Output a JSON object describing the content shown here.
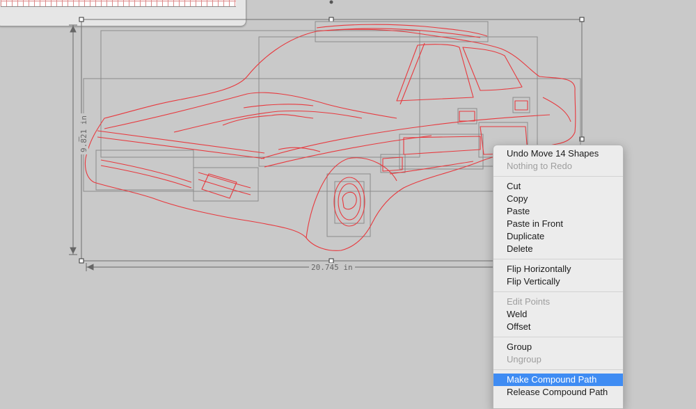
{
  "dimensions": {
    "width_label": "20.745 in",
    "height_label": "9.821 in"
  },
  "colors": {
    "canvas_bg": "#c9c9c9",
    "trace_line": "#e8383d",
    "bounding_box": "#8a8a8a",
    "menu_highlight": "#3f8cf3"
  },
  "context_menu": {
    "groups": [
      [
        {
          "label": "Undo Move 14 Shapes",
          "enabled": true
        },
        {
          "label": "Nothing to Redo",
          "enabled": false
        }
      ],
      [
        {
          "label": "Cut",
          "enabled": true
        },
        {
          "label": "Copy",
          "enabled": true
        },
        {
          "label": "Paste",
          "enabled": true
        },
        {
          "label": "Paste in Front",
          "enabled": true
        },
        {
          "label": "Duplicate",
          "enabled": true
        },
        {
          "label": "Delete",
          "enabled": true
        }
      ],
      [
        {
          "label": "Flip Horizontally",
          "enabled": true
        },
        {
          "label": "Flip Vertically",
          "enabled": true
        }
      ],
      [
        {
          "label": "Edit Points",
          "enabled": false
        },
        {
          "label": "Weld",
          "enabled": true
        },
        {
          "label": "Offset",
          "enabled": true
        }
      ],
      [
        {
          "label": "Group",
          "enabled": true
        },
        {
          "label": "Ungroup",
          "enabled": false
        }
      ],
      [
        {
          "label": "Make Compound Path",
          "enabled": true,
          "highlighted": true
        },
        {
          "label": "Release Compound Path",
          "enabled": true
        }
      ]
    ]
  }
}
